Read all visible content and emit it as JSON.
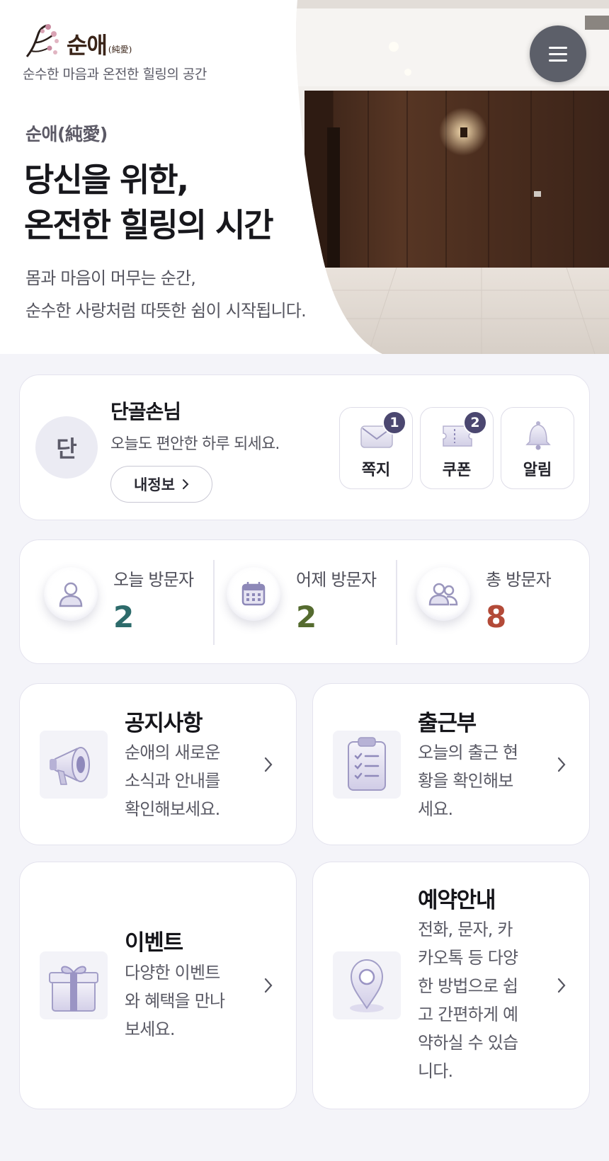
{
  "brand": {
    "logo_text": "순애",
    "logo_hanja": "(純愛)",
    "tagline": "순수한 마음과 온전한 힐링의 공간"
  },
  "hero": {
    "eyebrow": "순애(純愛)",
    "title_line1": "당신을 위한,",
    "title_line2": "온전한 힐링의 시간",
    "desc_line1": "몸과 마음이 머무는 순간,",
    "desc_line2": "순수한 사랑처럼 따뜻한 쉼이 시작됩니다."
  },
  "user": {
    "avatar_initial": "단",
    "name": "단골손님",
    "greeting": "오늘도 편안한 하루 되세요.",
    "myinfo_label": "내정보"
  },
  "quick": [
    {
      "label": "쪽지",
      "badge": "1",
      "icon": "envelope-icon"
    },
    {
      "label": "쿠폰",
      "badge": "2",
      "icon": "coupon-icon"
    },
    {
      "label": "알림",
      "badge": "",
      "icon": "bell-icon"
    }
  ],
  "stats": [
    {
      "label": "오늘 방문자",
      "value": "2",
      "color": "#2d6b6b",
      "icon": "user-icon"
    },
    {
      "label": "어제 방문자",
      "value": "2",
      "color": "#556b2f",
      "icon": "calendar-icon"
    },
    {
      "label": "총 방문자",
      "value": "8",
      "color": "#b34a38",
      "icon": "users-icon"
    }
  ],
  "menus": [
    {
      "title": "공지사항",
      "desc_lines": [
        "순애의 새로운",
        "소식과 안내를",
        "확인해보세요."
      ],
      "icon": "megaphone-icon"
    },
    {
      "title": "출근부",
      "desc_lines": [
        "오늘의 출근 현",
        "황을 확인해보",
        "세요."
      ],
      "icon": "clipboard-icon"
    },
    {
      "title": "이벤트",
      "desc_lines": [
        "다양한 이벤트",
        "와 혜택을 만나",
        "보세요."
      ],
      "icon": "gift-icon"
    },
    {
      "title": "예약안내",
      "desc_lines": [
        "전화, 문자, 카",
        "카오톡 등 다양",
        "한 방법으로 쉽",
        "고 간편하게 예",
        "약하실 수 있습",
        "니다."
      ],
      "icon": "location-pin-icon"
    }
  ],
  "colors": {
    "accent": "#4b4770",
    "background": "#f4f4f9"
  }
}
